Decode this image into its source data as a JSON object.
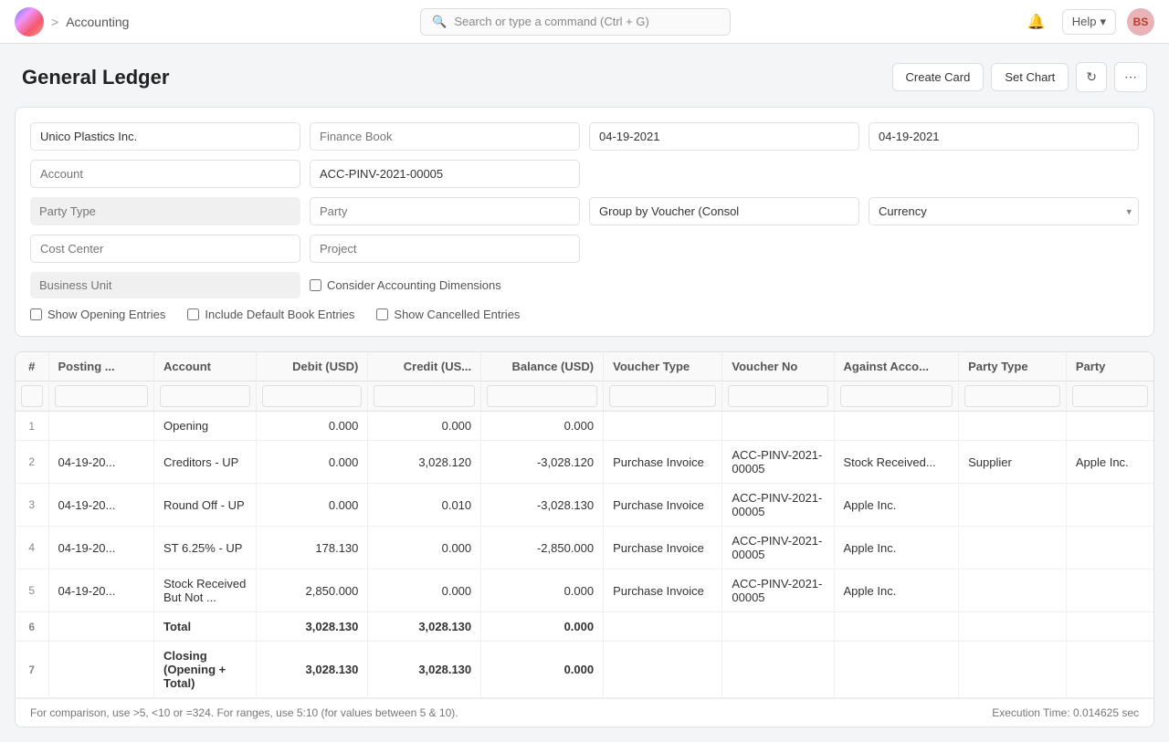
{
  "app": {
    "title": "Accounting",
    "breadcrumb_sep": ">",
    "logo_alt": "Frappe logo"
  },
  "nav": {
    "search_placeholder": "Search or type a command (Ctrl + G)",
    "help_label": "Help",
    "avatar_initials": "BS"
  },
  "page": {
    "title": "General Ledger",
    "create_card_label": "Create Card",
    "set_chart_label": "Set Chart"
  },
  "filters": {
    "company_value": "Unico Plastics Inc.",
    "finance_book_placeholder": "Finance Book",
    "from_date": "04-19-2021",
    "to_date": "04-19-2021",
    "account_placeholder": "Account",
    "account_value": "ACC-PINV-2021-00005",
    "party_type_placeholder": "Party Type",
    "party_placeholder": "Party",
    "group_by_value": "Group by Voucher (Consol",
    "currency_placeholder": "Currency",
    "cost_center_placeholder": "Cost Center",
    "project_placeholder": "Project",
    "business_unit_placeholder": "Business Unit",
    "consider_accounting_label": "Consider Accounting Dimensions",
    "show_opening_label": "Show Opening Entries",
    "include_default_label": "Include Default Book Entries",
    "show_cancelled_label": "Show Cancelled Entries"
  },
  "table": {
    "columns": [
      {
        "key": "num",
        "label": "#"
      },
      {
        "key": "posting_date",
        "label": "Posting ..."
      },
      {
        "key": "account",
        "label": "Account"
      },
      {
        "key": "debit",
        "label": "Debit (USD)"
      },
      {
        "key": "credit",
        "label": "Credit (US..."
      },
      {
        "key": "balance",
        "label": "Balance (USD)"
      },
      {
        "key": "voucher_type",
        "label": "Voucher Type"
      },
      {
        "key": "voucher_no",
        "label": "Voucher No"
      },
      {
        "key": "against_account",
        "label": "Against Acco..."
      },
      {
        "key": "party_type",
        "label": "Party Type"
      },
      {
        "key": "party",
        "label": "Party"
      }
    ],
    "rows": [
      {
        "num": "1",
        "posting_date": "",
        "account": "Opening",
        "debit": "0.000",
        "credit": "0.000",
        "balance": "0.000",
        "voucher_type": "",
        "voucher_no": "",
        "against_account": "",
        "party_type": "",
        "party": "",
        "bold": false
      },
      {
        "num": "2",
        "posting_date": "04-19-20...",
        "account": "Creditors - UP",
        "debit": "0.000",
        "credit": "3,028.120",
        "balance": "-3,028.120",
        "voucher_type": "Purchase Invoice",
        "voucher_no": "ACC-PINV-2021-00005",
        "against_account": "Stock Received...",
        "party_type": "Supplier",
        "party": "Apple Inc.",
        "bold": false
      },
      {
        "num": "3",
        "posting_date": "04-19-20...",
        "account": "Round Off - UP",
        "debit": "0.000",
        "credit": "0.010",
        "balance": "-3,028.130",
        "voucher_type": "Purchase Invoice",
        "voucher_no": "ACC-PINV-2021-00005",
        "against_account": "Apple Inc.",
        "party_type": "",
        "party": "",
        "bold": false
      },
      {
        "num": "4",
        "posting_date": "04-19-20...",
        "account": "ST 6.25% - UP",
        "debit": "178.130",
        "credit": "0.000",
        "balance": "-2,850.000",
        "voucher_type": "Purchase Invoice",
        "voucher_no": "ACC-PINV-2021-00005",
        "against_account": "Apple Inc.",
        "party_type": "",
        "party": "",
        "bold": false
      },
      {
        "num": "5",
        "posting_date": "04-19-20...",
        "account": "Stock Received But Not ...",
        "debit": "2,850.000",
        "credit": "0.000",
        "balance": "0.000",
        "voucher_type": "Purchase Invoice",
        "voucher_no": "ACC-PINV-2021-00005",
        "against_account": "Apple Inc.",
        "party_type": "",
        "party": "",
        "bold": false
      },
      {
        "num": "6",
        "posting_date": "",
        "account": "Total",
        "debit": "3,028.130",
        "credit": "3,028.130",
        "balance": "0.000",
        "voucher_type": "",
        "voucher_no": "",
        "against_account": "",
        "party_type": "",
        "party": "",
        "bold": true
      },
      {
        "num": "7",
        "posting_date": "",
        "account": "Closing (Opening + Total)",
        "debit": "3,028.130",
        "credit": "3,028.130",
        "balance": "0.000",
        "voucher_type": "",
        "voucher_no": "",
        "against_account": "",
        "party_type": "",
        "party": "",
        "bold": true
      }
    ]
  },
  "footer": {
    "hint": "For comparison, use >5, <10 or =324. For ranges, use 5:10 (for values between 5 & 10).",
    "execution_time": "Execution Time: 0.014625 sec"
  }
}
